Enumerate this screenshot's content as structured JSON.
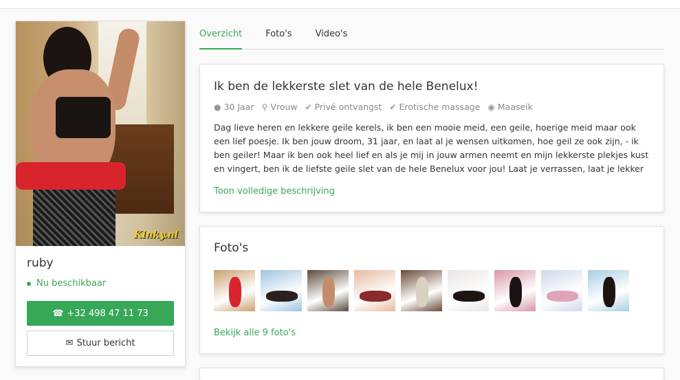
{
  "profile": {
    "name": "ruby",
    "status": "Nu beschikbaar",
    "phone_label": "+32 498 47 11 73",
    "message_label": "Stuur bericht",
    "photo_watermark": "Kinky.nl"
  },
  "tabs": [
    {
      "label": "Overzicht",
      "active": true
    },
    {
      "label": "Foto's",
      "active": false
    },
    {
      "label": "Video's",
      "active": false
    }
  ],
  "description": {
    "title": "Ik ben de lekkerste slet van de hele Benelux!",
    "meta": [
      {
        "icon": "user-icon",
        "text": "30 Jaar"
      },
      {
        "icon": "map-pin-icon",
        "text": "Vrouw"
      },
      {
        "icon": "check-icon",
        "text": "Privé ontvangst"
      },
      {
        "icon": "check-icon",
        "text": "Erotische massage"
      },
      {
        "icon": "location-marker-icon",
        "text": "Maaseik"
      }
    ],
    "text": "Dag lieve heren en lekkere geile kerels, ik ben een mooie meid, een geile, hoerige meid maar ook een lief poesje. Ik ben jouw droom, 31 jaar, en laat al je wensen uitkomen, hoe geil ze ook zijn, - ik ben geiler! Maar ik ben ook heel lief en als je mij in jouw armen neemt en mijn lekkerste plekjes kust en vingert, ben ik de liefste geile slet van de hele Benelux voor jou! Laat je verrassen, laat je lekker pijpen en je weet niet",
    "more_link": "Toon volledige beschrijving"
  },
  "photos": {
    "title": "Foto's",
    "thumbnails": [
      {
        "bg": "#c9a16f",
        "accent": "#d8242c"
      },
      {
        "bg": "#9fc4df",
        "accent": "#2b2020"
      },
      {
        "bg": "#5a4a3c",
        "accent": "#c48c69"
      },
      {
        "bg": "#e7b9a0",
        "accent": "#8a2b2b"
      },
      {
        "bg": "#6a4a36",
        "accent": "#d9d0c0"
      },
      {
        "bg": "#e8e6e3",
        "accent": "#1c1410"
      },
      {
        "bg": "#d996a8",
        "accent": "#1a1413"
      },
      {
        "bg": "#cfd9ea",
        "accent": "#e0a4b8"
      },
      {
        "bg": "#a9cde3",
        "accent": "#1c1410"
      }
    ],
    "all_link": "Bekijk alle 9 foto's"
  },
  "colors": {
    "accent_green": "#36a857",
    "meta_grey": "#888888"
  }
}
